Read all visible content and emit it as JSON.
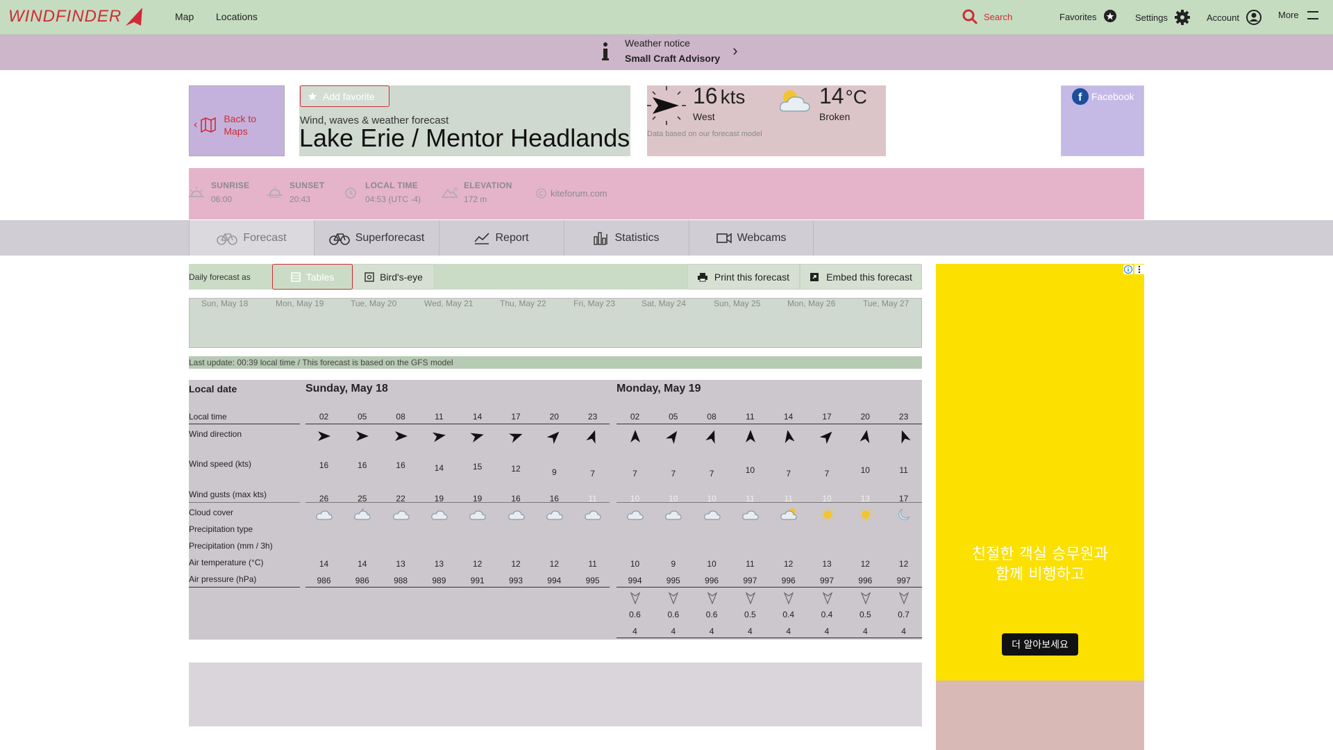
{
  "brand": {
    "logo": "WINDFINDER",
    "accent": "#d02b35"
  },
  "topnav": {
    "map": "Map",
    "locations": "Locations",
    "search": "Search",
    "favorites": "Favorites",
    "settings": "Settings",
    "account": "Account",
    "more": "More"
  },
  "notice": {
    "title": "Weather notice",
    "text": "Small Craft Advisory"
  },
  "back": {
    "label_line1": "Back to",
    "label_line2": "Maps"
  },
  "location": {
    "add_favorite": "Add favorite",
    "subtitle": "Wind, waves & weather forecast",
    "title": "Lake Erie / Mentor Headlands"
  },
  "now": {
    "wind_speed": "16",
    "wind_unit": "kts",
    "wind_dir": "West",
    "temp": "14",
    "temp_unit": "°C",
    "sky": "Broken",
    "note": "Data based on our forecast model"
  },
  "social": {
    "facebook": "Facebook"
  },
  "info": {
    "sunrise_label": "SUNRISE",
    "sunrise": "06:00",
    "sunset_label": "SUNSET",
    "sunset": "20:43",
    "localtime_label": "LOCAL TIME",
    "localtime": "04:53 (UTC -4)",
    "elevation_label": "ELEVATION",
    "elevation": "172 m",
    "credit": "kiteforum.com"
  },
  "tabs": [
    "Forecast",
    "Superforecast",
    "Report",
    "Statistics",
    "Webcams"
  ],
  "controls": {
    "daily_as": "Daily forecast as",
    "tables": "Tables",
    "birds_eye": "Bird's-eye",
    "print": "Print this forecast",
    "embed": "Embed this forecast"
  },
  "days": [
    "Sun, May 18",
    "Mon, May 19",
    "Tue, May 20",
    "Wed, May 21",
    "Thu, May 22",
    "Fri, May 23",
    "Sat, May 24",
    "Sun, May 25",
    "Mon, May 26",
    "Tue, May 27"
  ],
  "last_update": "Last update: 00:39 local time / This forecast is based on the GFS model",
  "table": {
    "row_labels": {
      "local_date": "Local date",
      "local_time": "Local time",
      "wind_dir": "Wind direction",
      "wind_speed": "Wind speed (kts)",
      "wind_gusts": "Wind gusts (max kts)",
      "cloud": "Cloud cover",
      "precip_type": "Precipitation type",
      "precip": "Precipitation (mm / 3h)",
      "air_temp": "Air temperature (°C)",
      "air_pressure": "Air pressure (hPa)"
    },
    "day1": {
      "title": "Sunday, May 18",
      "times": [
        "02",
        "05",
        "08",
        "11",
        "14",
        "17",
        "20",
        "23"
      ],
      "wind_dir_deg": [
        270,
        270,
        270,
        260,
        255,
        250,
        225,
        200
      ],
      "wind_speed": [
        "16",
        "16",
        "16",
        "14",
        "15",
        "12",
        "9",
        "7"
      ],
      "gusts": [
        "26",
        "25",
        "22",
        "19",
        "19",
        "16",
        "16",
        "11"
      ],
      "cloud": [
        "cloud",
        "cloud-moon",
        "cloud",
        "cloud",
        "cloud",
        "cloud",
        "cloud",
        "cloud"
      ],
      "temp": [
        "14",
        "14",
        "13",
        "13",
        "12",
        "12",
        "12",
        "11"
      ],
      "pressure": [
        "986",
        "986",
        "988",
        "989",
        "991",
        "993",
        "994",
        "995"
      ]
    },
    "day2": {
      "title": "Monday, May 19",
      "times": [
        "02",
        "05",
        "08",
        "11",
        "14",
        "17",
        "20",
        "23"
      ],
      "wind_dir_deg": [
        180,
        215,
        200,
        180,
        170,
        225,
        190,
        160
      ],
      "wind_speed": [
        "7",
        "7",
        "7",
        "10",
        "7",
        "7",
        "10",
        "11"
      ],
      "gusts": [
        "10",
        "10",
        "10",
        "11",
        "11",
        "10",
        "13",
        "17"
      ],
      "cloud": [
        "cloud",
        "cloud",
        "cloud",
        "cloud",
        "cloud-sun",
        "sun",
        "sun",
        "moon"
      ],
      "temp": [
        "10",
        "9",
        "10",
        "11",
        "12",
        "13",
        "12",
        "12"
      ],
      "pressure": [
        "994",
        "995",
        "996",
        "997",
        "996",
        "997",
        "996",
        "997"
      ],
      "wave_height": [
        "0.6",
        "0.6",
        "0.6",
        "0.5",
        "0.4",
        "0.4",
        "0.5",
        "0.7"
      ],
      "wave_period": [
        "4",
        "4",
        "4",
        "4",
        "4",
        "4",
        "4",
        "4"
      ]
    }
  },
  "ad": {
    "text_line1": "친절한 객실 승무원과",
    "text_line2": "함께 비행하고",
    "cta": "더 알아보세요"
  }
}
